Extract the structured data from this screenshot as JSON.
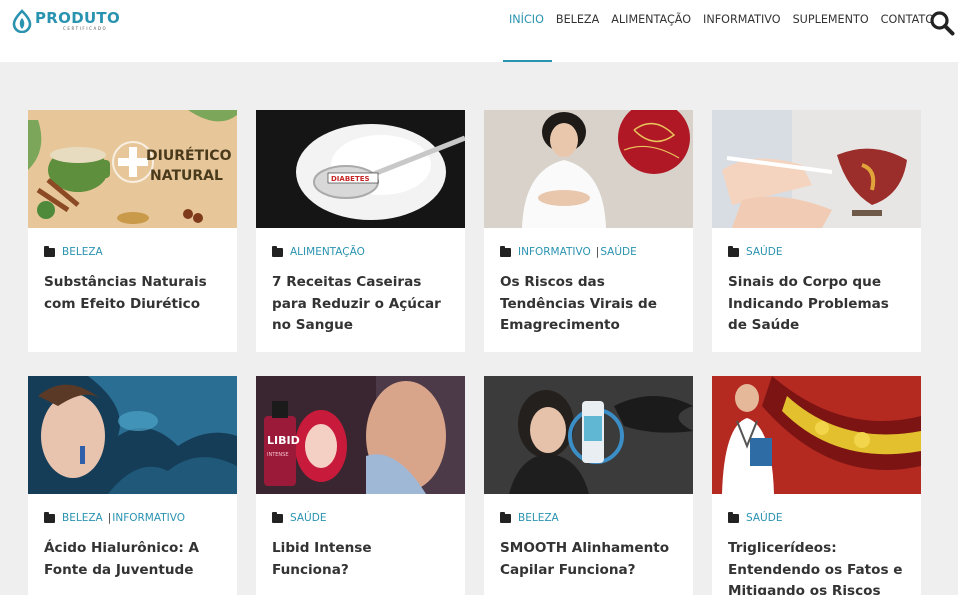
{
  "brand": {
    "name": "PRODUTO",
    "tagline": "CERTIFICADO",
    "color": "#2a93b0"
  },
  "nav": {
    "items": [
      {
        "label": "INÍCIO",
        "active": true
      },
      {
        "label": "BELEZA",
        "active": false
      },
      {
        "label": "ALIMENTAÇÃO",
        "active": false
      },
      {
        "label": "INFORMATIVO",
        "active": false
      },
      {
        "label": "SUPLEMENTO",
        "active": false
      },
      {
        "label": "CONTATO",
        "active": false
      }
    ],
    "search_icon": "search-icon"
  },
  "posts": [
    {
      "image_text_1": "DIURÉTICO",
      "image_text_2": "NATURAL",
      "categories": [
        "BELEZA"
      ],
      "title": "Substâncias Naturais com Efeito Diurético"
    },
    {
      "image_text_1": "DIABETES",
      "categories": [
        "ALIMENTAÇÃO"
      ],
      "title": "7 Receitas Caseiras para Reduzir o Açúcar no Sangue"
    },
    {
      "categories": [
        "INFORMATIVO",
        "SAÚDE"
      ],
      "title": "Os Riscos das Tendências Virais de Emagrecimento"
    },
    {
      "categories": [
        "SAÚDE"
      ],
      "title": "Sinais do Corpo que Indicando Problemas de Saúde"
    },
    {
      "categories": [
        "BELEZA",
        "INFORMATIVO"
      ],
      "title": "Ácido Hialurônico: A Fonte da Juventude"
    },
    {
      "image_text_1": "LIBID",
      "image_text_2": "INTENSE",
      "categories": [
        "SAÚDE"
      ],
      "title": "Libid Intense Funciona?"
    },
    {
      "categories": [
        "BELEZA"
      ],
      "title": "SMOOTH Alinhamento Capilar Funciona?"
    },
    {
      "categories": [
        "SAÚDE"
      ],
      "title": "Triglicerídeos: Entendendo os Fatos e Mitigando os Riscos"
    }
  ]
}
